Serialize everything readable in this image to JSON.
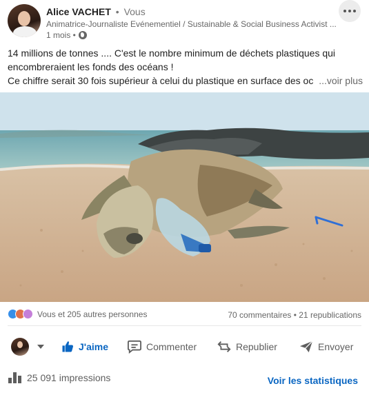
{
  "author": {
    "name": "Alice VACHET",
    "separator": "•",
    "relation": "Vous",
    "headline": "Animatrice-Journaliste Evénementiel / Sustainable & Social Business Activist ...",
    "time": "1 mois •"
  },
  "post": {
    "lines": [
      "14 millions de tonnes .... C'est le nombre minimum de déchets plastiques qui",
      "encombreraient les fonds des océans !",
      "Ce chiffre serait 30 fois supérieur à celui du plastique en surface des oc"
    ],
    "see_more": "...voir plus"
  },
  "social": {
    "reactions_text": "Vous et 205 autres personnes",
    "comments_reposts": "70 commentaires • 21 republications"
  },
  "actions": {
    "like": "J'aime",
    "comment": "Commenter",
    "repost": "Republier",
    "send": "Envoyer"
  },
  "footer": {
    "impressions": "25 091 impressions",
    "stats_link": "Voir les statistiques"
  },
  "colors": {
    "brand_blue": "#0a66c2",
    "muted_text": "#666666",
    "like_reaction": "#378fe9",
    "love_reaction": "#df704d",
    "insight_reaction": "#c57fd9"
  },
  "icons": [
    "globe-icon",
    "more-options-icon",
    "like-icon",
    "comment-icon",
    "repost-icon",
    "send-icon",
    "chart-bars-icon",
    "chevron-down-icon"
  ]
}
